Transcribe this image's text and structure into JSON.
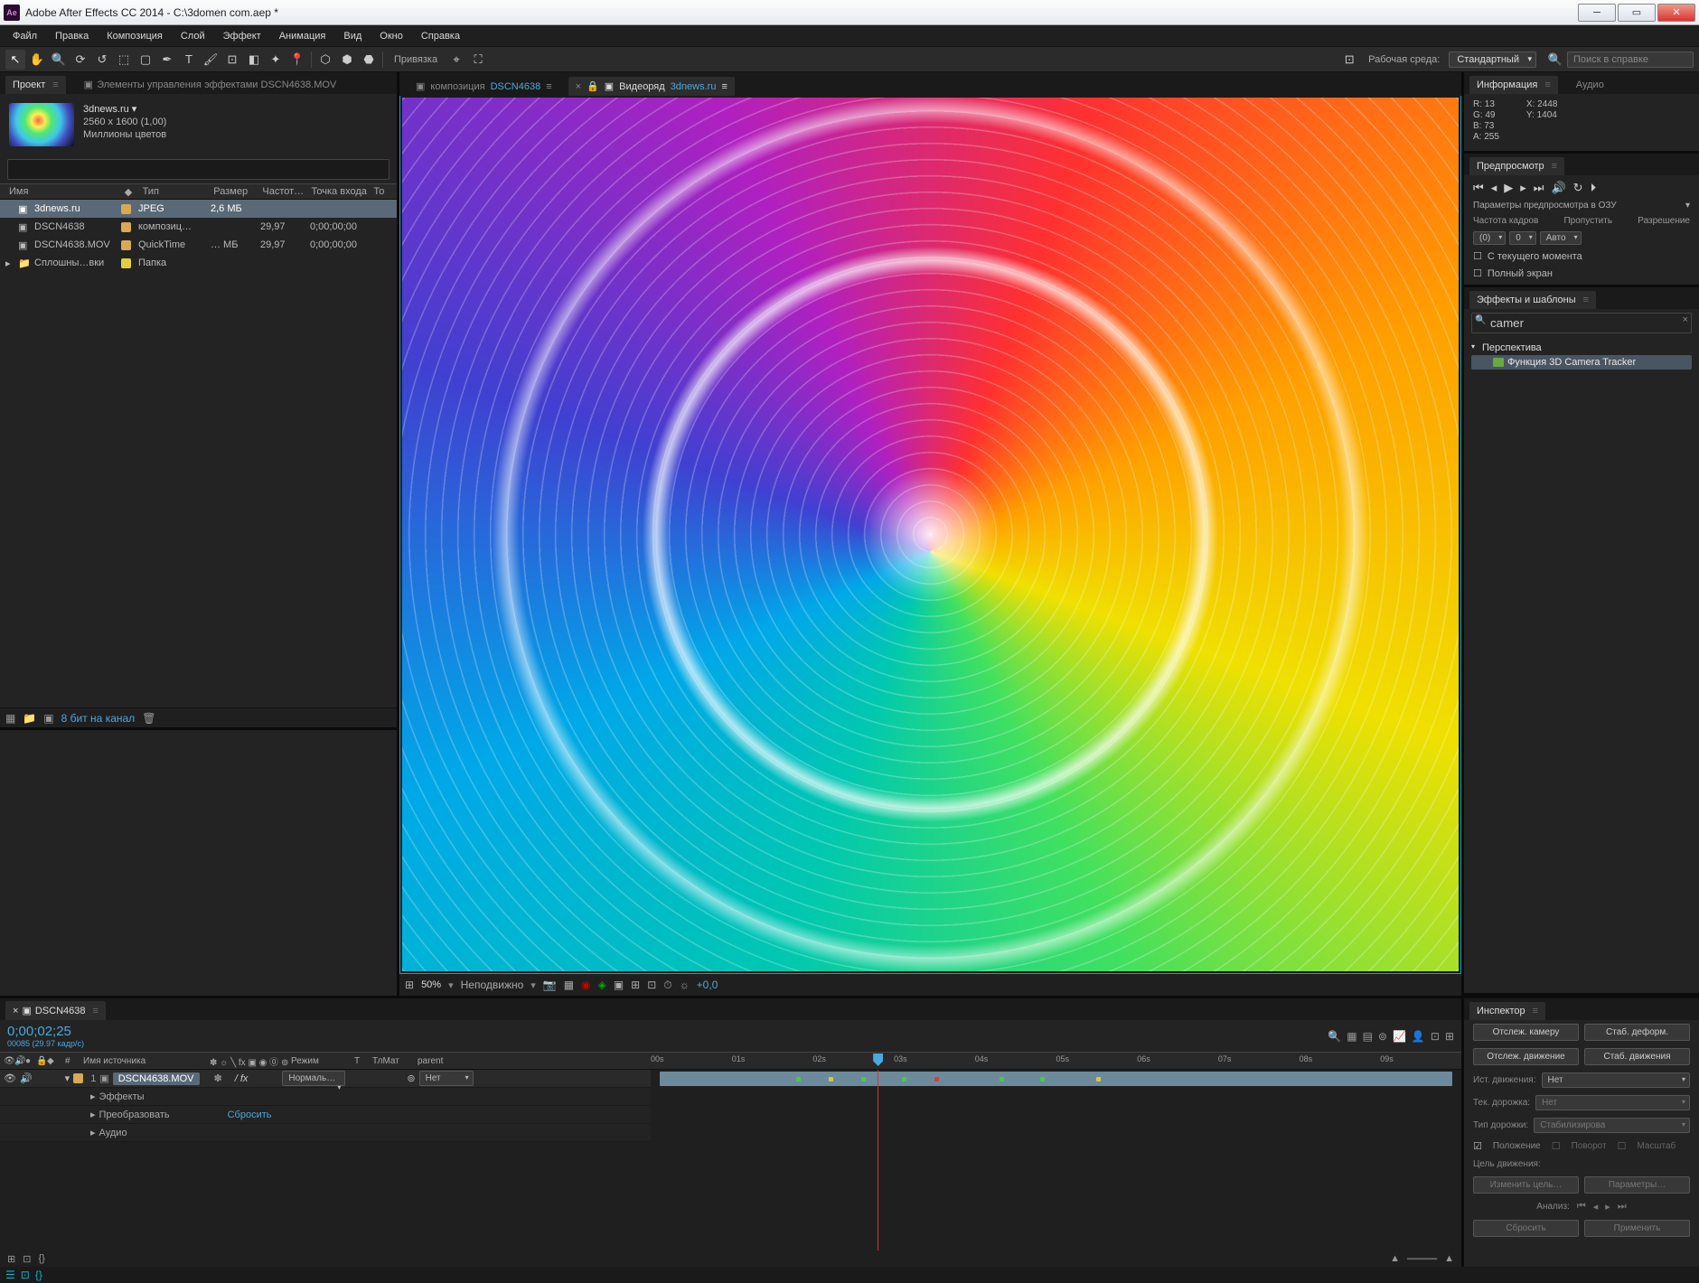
{
  "window": {
    "title": "Adobe After Effects CC 2014 - C:\\3domen com.aep *"
  },
  "menu": [
    "Файл",
    "Правка",
    "Композиция",
    "Слой",
    "Эффект",
    "Анимация",
    "Вид",
    "Окно",
    "Справка"
  ],
  "toolbar": {
    "snap": "Привязка",
    "workspace_label": "Рабочая среда:",
    "workspace_value": "Стандартный",
    "search_placeholder": "Поиск в справке"
  },
  "project": {
    "tab": "Проект",
    "eff_controls": "Элементы управления эффектами  DSCN4638.MOV",
    "item_name": "3dnews.ru ▾",
    "item_dim": "2560 x 1600 (1,00)",
    "item_colors": "Миллионы цветов",
    "headers": {
      "name": "Имя",
      "type": "Тип",
      "size": "Размер",
      "rate": "Частот…",
      "in": "Точка входа",
      "out": "То"
    },
    "rows": [
      {
        "name": "3dnews.ru",
        "type": "JPEG",
        "size": "2,6 МБ",
        "rate": "",
        "in": "",
        "sw": "#d8aa55",
        "sel": true,
        "icon": "▣"
      },
      {
        "name": "DSCN4638",
        "type": "композиц…",
        "size": "",
        "rate": "29,97",
        "in": "0;00;00;00",
        "sw": "#d8aa55",
        "icon": "▣"
      },
      {
        "name": "DSCN4638.MOV",
        "type": "QuickTime",
        "size": "… МБ",
        "rate": "29,97",
        "in": "0;00;00;00",
        "sw": "#d8aa55",
        "icon": "▣"
      },
      {
        "name": "Сплошны…вки",
        "type": "Папка",
        "size": "",
        "rate": "",
        "in": "",
        "sw": "#e0d040",
        "icon": "📁"
      }
    ],
    "bpc": "8 бит на канал"
  },
  "viewer": {
    "tabs": [
      {
        "label": "композиция",
        "name": "DSCN4638",
        "active": false,
        "icon": "▣"
      },
      {
        "label": "Видеоряд",
        "name": "3dnews.ru",
        "active": true,
        "icon": "🔒 ▣"
      }
    ],
    "zoom": "50%",
    "mode": "Неподвижно",
    "coord": "+0,0"
  },
  "info_panel": {
    "tab": "Информация",
    "audio_tab": "Аудио",
    "r": "R:  13",
    "g": "G:  49",
    "b": "B:  73",
    "a": "A:  255",
    "x": "X:  2448",
    "y": "Y:  1404"
  },
  "preview": {
    "tab": "Предпросмотр",
    "ram_label": "Параметры предпросмотра в ОЗУ",
    "opt_headers": [
      "Частота кадров",
      "Пропустить",
      "Разрешение"
    ],
    "opts": [
      "(0)",
      "0",
      "Авто"
    ],
    "from_current": "С текущего момента",
    "fullscreen": "Полный экран"
  },
  "effects": {
    "tab": "Эффекты и шаблоны",
    "search": "camer",
    "category": "Перспектива",
    "item": "Функция 3D Camera Tracker"
  },
  "timeline": {
    "tab": "DSCN4638",
    "time": "0;00;02;25",
    "frame": "00085 (29.97 кадр/с)",
    "col_source": "Имя источника",
    "col_mode": "Режим",
    "col_t": "T",
    "col_trk": "ТлМат",
    "col_parent": "parent",
    "ticks": [
      "00s",
      "01s",
      "02s",
      "03s",
      "04s",
      "05s",
      "06s",
      "07s",
      "08s",
      "09s"
    ],
    "layer": "DSCN4638.MOV",
    "mode_val": "Нормаль…",
    "parent_val": "Нет",
    "sub1": "Эффекты",
    "sub2": "Преобразовать",
    "sub3": "Аудио",
    "reset": "Сбросить"
  },
  "inspector": {
    "tab": "Инспектор",
    "btns1": [
      "Отслеж. камеру",
      "Стаб. деформ."
    ],
    "btns2": [
      "Отслеж. движение",
      "Стаб. движения"
    ],
    "source_label": "Ист. движения:",
    "source_val": "Нет",
    "track_label": "Тек. дорожка:",
    "track_val": "Нет",
    "track_type_label": "Тип дорожки:",
    "track_type_val": "Стабилизирова",
    "cb1": "Положение",
    "cb2": "Поворот",
    "cb3": "Масштаб",
    "target": "Цель движения:",
    "btns3": [
      "Изменить цель…",
      "Параметры…"
    ],
    "analysis": "Анализ:",
    "btns4": [
      "Сбросить",
      "Применить"
    ]
  }
}
